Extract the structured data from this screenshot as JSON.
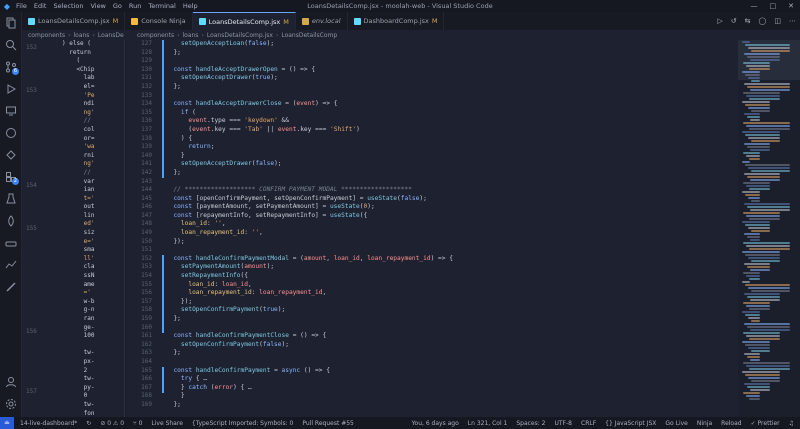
{
  "window": {
    "menu": [
      "File",
      "Edit",
      "Selection",
      "View",
      "Go",
      "Run",
      "Terminal",
      "Help"
    ],
    "title": "LoansDetailsComp.jsx - moolah-web - Visual Studio Code"
  },
  "tabs": [
    {
      "label": "LoansDetailsComp.jsx",
      "suffix": "M",
      "color": "#61dafb",
      "active": false,
      "italic": false
    },
    {
      "label": "Console Ninja",
      "suffix": "",
      "color": "#f5b942",
      "active": false,
      "italic": false
    },
    {
      "label": "LoansDetailsComp.jsx",
      "suffix": "M",
      "color": "#61dafb",
      "active": true,
      "italic": false
    },
    {
      "label": "env.local",
      "suffix": "",
      "color": "#d4a84a",
      "active": false,
      "italic": true
    },
    {
      "label": "DashboardComp.jsx",
      "suffix": "M",
      "color": "#61dafb",
      "active": false,
      "italic": false
    }
  ],
  "breadcrumb_left": [
    "components",
    "loans",
    "LoansDe"
  ],
  "breadcrumb_main": [
    "components",
    "loans",
    "LoansDetailsComp.jsx",
    "LoansDetailsComp"
  ],
  "side_editor": {
    "line_numbers": [
      "152",
      "153",
      "154",
      "155",
      "156",
      "157"
    ],
    "lines": [
      ") else (",
      "  return",
      "    (",
      "    <Chip",
      "      lab",
      "      el=",
      "      'Pe",
      "      ndi",
      "      ng'",
      "      //",
      "      col",
      "      or=",
      "      'wa",
      "      rni",
      "      ng'",
      "      //",
      "      var",
      "      ian",
      "      t='",
      "      out",
      "      lin",
      "      ed'",
      "      siz",
      "      e='",
      "      sma",
      "      ll'",
      "      cla",
      "      ssN",
      "      ame",
      "      ='",
      "      w-b",
      "      g-n",
      "      ran",
      "      ge-",
      "      100",
      "",
      "      tw-",
      "      px-",
      "      2",
      "      tw-",
      "      py-",
      "      0",
      "      tw-",
      "      fon"
    ]
  },
  "editor": {
    "line_numbers": [
      "127",
      "128",
      "129",
      "130",
      "131",
      "132",
      "133",
      "134",
      "135",
      "136",
      "137",
      "138",
      "139",
      "140",
      "141",
      "142",
      "143",
      "144",
      "145",
      "146",
      "147",
      "148",
      "149",
      "150",
      "151",
      "152",
      "153",
      "154",
      "155",
      "156",
      "157",
      "158",
      "159",
      "160",
      "161",
      "162",
      "163",
      "164",
      "165",
      "166",
      "167",
      "168",
      "169"
    ],
    "lines": [
      "    setOpenAcceptLoan(false);",
      "  };",
      "",
      "  const handleAcceptDrawerOpen = () => {",
      "    setOpenAcceptDrawer(true);",
      "  };",
      "",
      "  const handleAcceptDrawerClose = (event) => {",
      "    if (",
      "      event.type === 'keydown' &&",
      "      (event.key === 'Tab' || event.key === 'Shift')",
      "    ) {",
      "      return;",
      "    }",
      "    setOpenAcceptDrawer(false);",
      "  };",
      "",
      "  // ******************* CONFIRM PAYMENT MODAL *******************",
      "  const [openConfirmPayment, setOpenConfirmPayment] = useState(false);",
      "  const [paymentAmount, setPaymentAmount] = useState(0);",
      "  const [repaymentInfo, setRepaymentInfo] = useState({",
      "    loan_id: '',",
      "    loan_repayment_id: '',",
      "  });",
      "",
      "  const handleConfirmPaymentModal = (amount, loan_id, loan_repayment_id) => {",
      "    setPaymentAmount(amount);",
      "    setRepaymentInfo({",
      "      loan_id: loan_id,",
      "      loan_repayment_id: loan_repayment_id,",
      "    });",
      "    setOpenConfirmPayment(true);",
      "  };",
      "",
      "  const handleConfirmPaymentClose = () => {",
      "    setOpenConfirmPayment(false);",
      "  };",
      "",
      "  const handleConfirmPayment = async () => {",
      "    try { …",
      "    } catch (error) { …",
      "    }",
      "  };"
    ]
  },
  "status": {
    "branch": "14-live-dashboard*",
    "sync": "↻",
    "problems": "⊘ 0  ⚠ 0",
    "ports": "⑂ 0",
    "live_share": "Live Share",
    "ts_info": "{TypeScript Imported: Symbols: 0",
    "pr": "Pull Request #55",
    "blame": "You, 6 days ago",
    "position": "Ln 321, Col 1",
    "spaces": "Spaces: 2",
    "encoding": "UTF-8",
    "eol": "CRLF",
    "language": "{} JavaScript JSX",
    "golive": "Go Live",
    "ninja": "Ninja",
    "reload": "Reload",
    "prettier": "✓ Prettier"
  },
  "colors": {
    "accent": "#4aa3ff",
    "keyword": "#8ab4ff",
    "string": "#e3a86a",
    "parameter": "#ff8f8f"
  }
}
